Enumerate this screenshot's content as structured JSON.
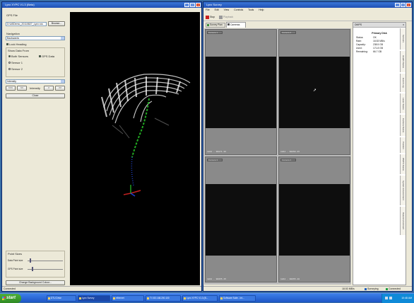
{
  "left_window": {
    "title": "Lynx XYPC V1.3 (Beta)",
    "gps_file_label": "GPS File",
    "gps_file_value": "D:\\ASDemo_20110827_Lynx.ros",
    "browse_label": "Browse...",
    "navigation_label": "Navigation",
    "navigation_value": "Backwards",
    "lock_heading_label": "Lock Heading",
    "show_data_from_label": "Show Data From",
    "options": {
      "both_sensors": "Both Sensors",
      "gps_data": "GPS Data",
      "sensor1": "Sensor 1",
      "sensor2": "Sensor 2"
    },
    "color_mode_value": "Intensity",
    "nav_buttons": [
      "<<<",
      "<<",
      "Intensity",
      ">",
      ">>"
    ],
    "close_label": "Close",
    "point_sizes_label": "Point Sizes",
    "data_point_size_label": "Data Point size",
    "gps_point_size_label": "GPS Point size",
    "change_bg_label": "Change Background Colour...",
    "status_text": "Connected"
  },
  "right_window": {
    "title": "Lynx Survey",
    "menu": [
      "File",
      "Edit",
      "View",
      "Controls",
      "Tools",
      "Help"
    ],
    "toolbar": {
      "stop": "Stop",
      "playback": "Playback"
    },
    "tabs": [
      "Survey Plan",
      "Cameras"
    ],
    "cameras": [
      {
        "label": "Camera 1",
        "footer": "1844 - 99871.36"
      },
      {
        "label": "Camera 2",
        "footer": "1844 - 99950.35"
      },
      {
        "label": "Camera 3",
        "footer": "1844 - 99955.45"
      },
      {
        "label": "Camera 4",
        "footer": "1844 - 99955.40"
      }
    ],
    "panel_title": "DMPS",
    "disk": {
      "heading": "Primary Disk",
      "rows": [
        {
          "k": "Status:",
          "v": "OK"
        },
        {
          "k": "Rate:",
          "v": "18.53 MB/s"
        },
        {
          "k": "Capacity:",
          "v": "238.5 GB"
        },
        {
          "k": "Used:",
          "v": "171.8 GB"
        },
        {
          "k": "Remaining:",
          "v": "66.7 GB"
        }
      ]
    },
    "side_tabs": [
      "Sensors",
      "Health Status",
      "Event Log",
      "Laser Status",
      "Camera Status",
      "Position",
      "DMPS Status",
      "System Environment",
      "Data Environment"
    ],
    "status": {
      "rate": "18.53 MB/s",
      "surveying": "Surveying",
      "connected": "Connected"
    }
  },
  "taskbar": {
    "start_label": "start",
    "items": [
      "DTU Drive",
      "Lynx Survey",
      "ethernet",
      "TI 192.168.200.100",
      "Lynx XYPC V1.3 (B...",
      "Software Suite - Int..."
    ],
    "clock": "10:48 AM"
  },
  "colors": {
    "viewport_bg": "#000000",
    "title_bar": "#2a5fc8",
    "taskbar": "#245edb",
    "start": "#3c9c2e",
    "gps_track": "#22aa22"
  }
}
